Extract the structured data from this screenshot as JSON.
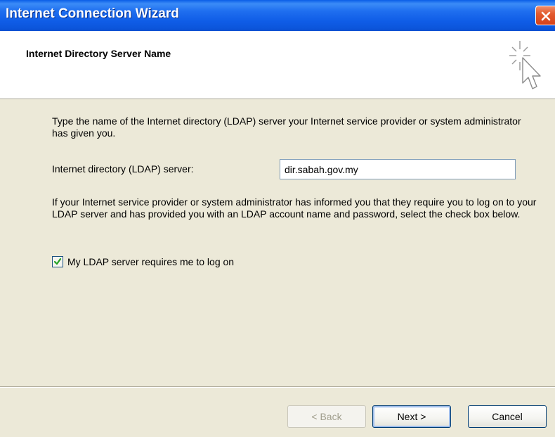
{
  "window": {
    "title": "Internet Connection Wizard",
    "close_icon": "close-icon"
  },
  "header": {
    "title": "Internet Directory Server Name",
    "icon": "wizard-cursor-icon"
  },
  "main": {
    "intro_text": "Type the name of the Internet directory (LDAP) server your Internet service provider or system administrator has given you.",
    "server_label": "Internet directory (LDAP) server:",
    "server_value": "dir.sabah.gov.my",
    "info_text": "If your Internet service provider or system administrator has informed you that they require you to log on to your LDAP server and has provided you with an LDAP account name and password, select the check box below.",
    "logon_checkbox": {
      "label": "My LDAP server requires me to log on",
      "checked": true
    }
  },
  "footer": {
    "back_label": "< Back",
    "next_label": "Next >",
    "cancel_label": "Cancel"
  },
  "colors": {
    "titlebar": "#0c56dc",
    "dialog_background": "#ece9d8",
    "checkmark": "#21a121"
  }
}
